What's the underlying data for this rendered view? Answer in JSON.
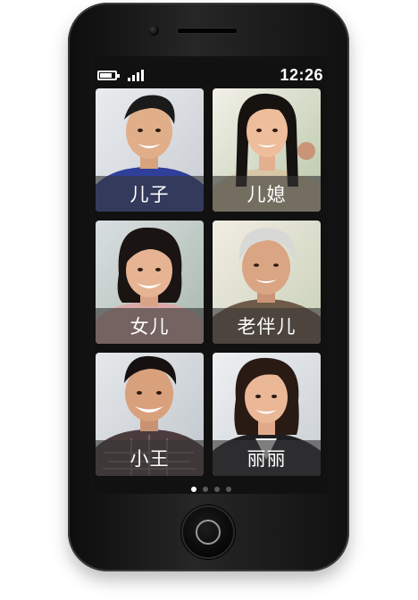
{
  "status_bar": {
    "time": "12:26",
    "battery_icon": "battery-icon",
    "battery_level": 0.8,
    "signal_icon": "signal-icon",
    "signal_bars": 4
  },
  "contacts": [
    {
      "name": "儿子",
      "avatar": "avatar-young-man"
    },
    {
      "name": "儿媳",
      "avatar": "avatar-young-woman"
    },
    {
      "name": "女儿",
      "avatar": "avatar-woman"
    },
    {
      "name": "老伴儿",
      "avatar": "avatar-elderly-man"
    },
    {
      "name": "小王",
      "avatar": "avatar-man-glasses-free"
    },
    {
      "name": "丽丽",
      "avatar": "avatar-woman-suit"
    }
  ],
  "pager": {
    "pages": 4,
    "current": 1
  },
  "colors": {
    "screen": "#111111",
    "name_bar": "rgba(55,55,55,0.62)",
    "active_dot": "#ffffff",
    "inactive_dot": "#5a5a5a"
  }
}
